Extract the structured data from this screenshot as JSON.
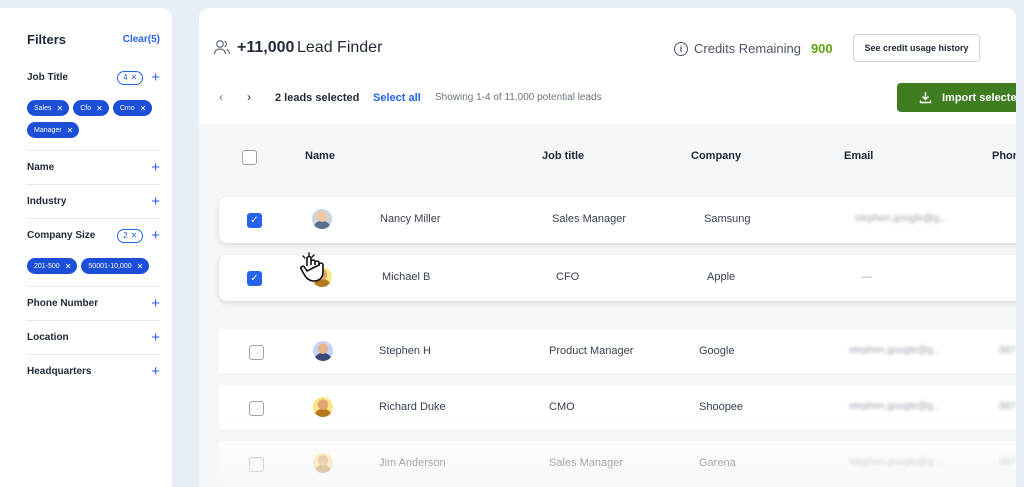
{
  "sidebar": {
    "title": "Filters",
    "clear": "Clear(5)",
    "job_title": {
      "label": "Job Title",
      "count": "4",
      "chips": [
        "Sales",
        "Cfo",
        "Cmo",
        "Manager"
      ]
    },
    "name": {
      "label": "Name"
    },
    "industry": {
      "label": "Industry"
    },
    "company_size": {
      "label": "Company Size",
      "count": "2",
      "chips": [
        "201-500",
        "50001-10,000"
      ]
    },
    "phone": {
      "label": "Phone Number"
    },
    "location": {
      "label": "Location"
    },
    "headquarters": {
      "label": "Headquarters"
    }
  },
  "header": {
    "count": "+11,000",
    "name": "Lead Finder",
    "credits_label": "Credits Remaining",
    "credits_value": "900",
    "usage_button": "See credit usage history"
  },
  "toolbar": {
    "selected": "2 leads selected",
    "select_all": "Select all",
    "showing": "Showing 1-4 of 11,000 potential leads",
    "import": "Import selecte"
  },
  "table": {
    "columns": [
      "Name",
      "Job title",
      "Company",
      "Email",
      "Phon"
    ],
    "rows": [
      {
        "name": "Nancy Miller",
        "title": "Sales Manager",
        "company": "Samsung",
        "email": "stephen.google@g...",
        "phone": "",
        "selected": true
      },
      {
        "name": "Michael B",
        "title": "CFO",
        "company": "Apple",
        "email": "—",
        "phone": "",
        "selected": true
      },
      {
        "name": "Stephen H",
        "title": "Product Manager",
        "company": "Google",
        "email": "stephen.google@g...",
        "phone": "987",
        "selected": false
      },
      {
        "name": "Richard Duke",
        "title": "CMO",
        "company": "Shoopee",
        "email": "stephen.google@g...",
        "phone": "987",
        "selected": false
      },
      {
        "name": "Jim Anderson",
        "title": "Sales Manager",
        "company": "Garena",
        "email": "stephen.google@g...",
        "phone": "987",
        "selected": false
      }
    ]
  },
  "colors": {
    "accent": "#2563eb",
    "import": "#3f7d20",
    "credits": "#65a30d"
  }
}
